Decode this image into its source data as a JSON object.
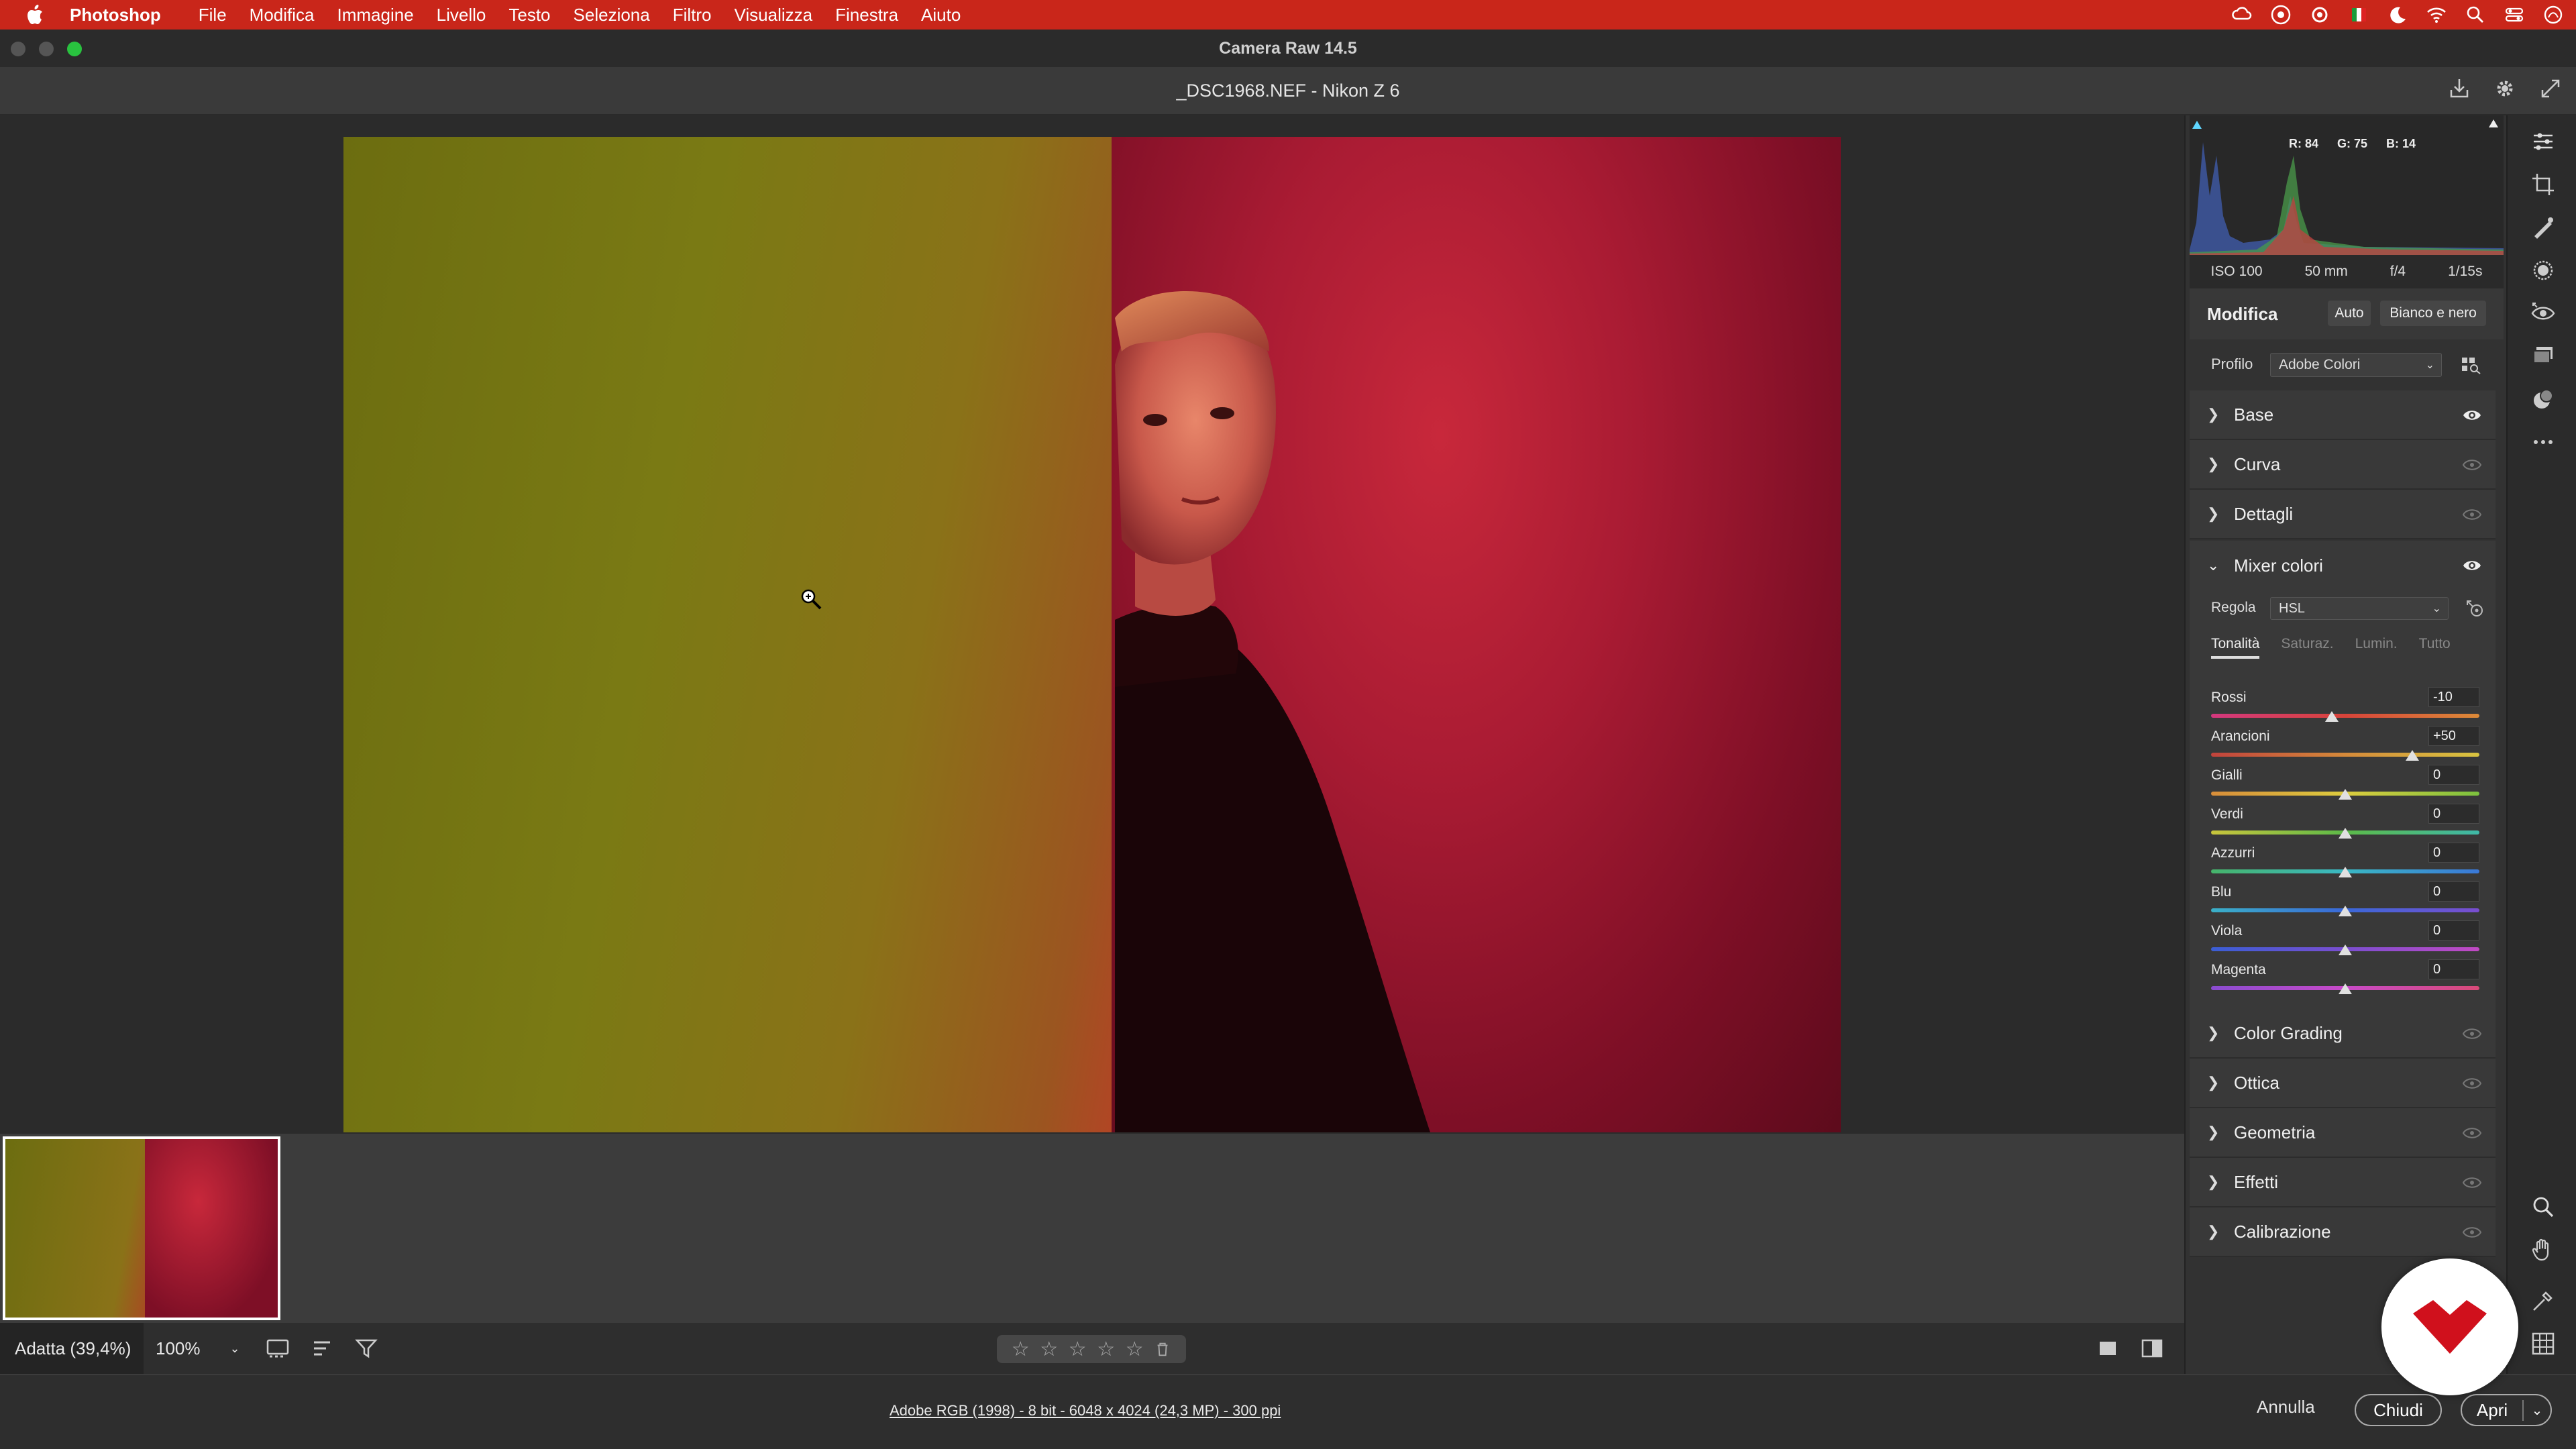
{
  "menubar": {
    "app_name": "Photoshop",
    "items": [
      "File",
      "Modifica",
      "Immagine",
      "Livello",
      "Testo",
      "Seleziona",
      "Filtro",
      "Visualizza",
      "Finestra",
      "Aiuto"
    ]
  },
  "window": {
    "title": "Camera Raw 14.5"
  },
  "file": {
    "title": "_DSC1968.NEF  -  Nikon Z 6"
  },
  "histogram": {
    "r": "R: 84",
    "g": "G: 75",
    "b": "B: 14"
  },
  "exif": {
    "iso": "ISO 100",
    "focal": "50 mm",
    "aperture": "f/4",
    "shutter": "1/15s"
  },
  "edit": {
    "title": "Modifica",
    "auto_label": "Auto",
    "bw_label": "Bianco e nero"
  },
  "profile": {
    "label": "Profilo",
    "value": "Adobe Colori"
  },
  "sections_top": [
    {
      "label": "Base"
    },
    {
      "label": "Curva"
    },
    {
      "label": "Dettagli"
    }
  ],
  "mixer": {
    "title": "Mixer colori",
    "regola_label": "Regola",
    "regola_value": "HSL",
    "tabs": [
      "Tonalità",
      "Saturaz.",
      "Lumin.",
      "Tutto"
    ],
    "sliders": [
      {
        "name": "Rossi",
        "value": "-10",
        "level": -10
      },
      {
        "name": "Arancioni",
        "value": "+50",
        "level": 50
      },
      {
        "name": "Gialli",
        "value": "0",
        "level": 0
      },
      {
        "name": "Verdi",
        "value": "0",
        "level": 0
      },
      {
        "name": "Azzurri",
        "value": "0",
        "level": 0
      },
      {
        "name": "Blu",
        "value": "0",
        "level": 0
      },
      {
        "name": "Viola",
        "value": "0",
        "level": 0
      },
      {
        "name": "Magenta",
        "value": "0",
        "level": 0
      }
    ]
  },
  "sections_bottom": [
    {
      "label": "Color Grading"
    },
    {
      "label": "Ottica"
    },
    {
      "label": "Geometria"
    },
    {
      "label": "Effetti"
    },
    {
      "label": "Calibrazione"
    }
  ],
  "bottombar": {
    "fit_label": "Adatta (39,4%)",
    "zoom": "100%"
  },
  "rating": {
    "stars": 5,
    "star_glyph": "☆"
  },
  "footer": {
    "file_info": "Adobe RGB (1998) - 8 bit - 6048 x 4024 (24,3 MP) - 300 ppi",
    "cancel": "Annulla",
    "close": "Chiudi",
    "open": "Apri"
  },
  "colors": {
    "menubar": "#c9261a",
    "accent_badge": "#d0101c"
  }
}
